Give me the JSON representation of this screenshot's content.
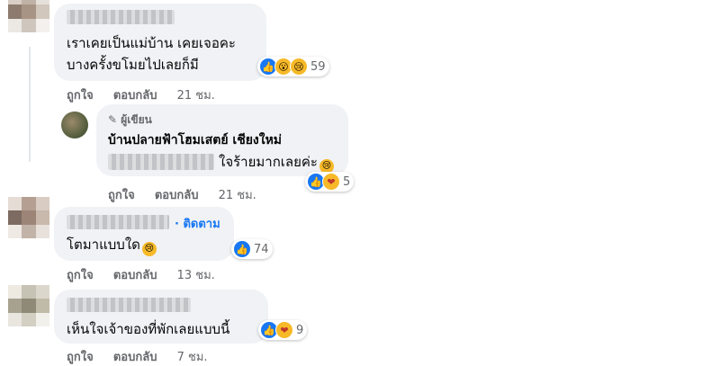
{
  "comments": [
    {
      "body_lines": [
        "เราเคยเป็นแม่บ้าน เคยเจอคะ",
        "บางครั้งขโมยไปเลยก็มี"
      ],
      "reactions": {
        "icons": [
          "like-icon",
          "wow-icon",
          "sad-icon"
        ],
        "count": "59"
      },
      "actions": {
        "like": "ถูกใจ",
        "reply": "ตอบกลับ",
        "time": "21 ชม."
      }
    },
    {
      "badge": "ผู้เขียน",
      "author": "บ้านปลายฟ้าโฮมเสตย์ เชียงใหม่",
      "body": "ใจร้ายมากเลยค่ะ",
      "reactions": {
        "icons": [
          "like-icon",
          "care-icon"
        ],
        "count": "5"
      },
      "actions": {
        "like": "ถูกใจ",
        "reply": "ตอบกลับ",
        "time": "21 ชม."
      }
    },
    {
      "follow": "· ติดตาม",
      "body": "โตมาแบบใด",
      "reactions": {
        "icons": [
          "like-icon"
        ],
        "count": "74"
      },
      "actions": {
        "like": "ถูกใจ",
        "reply": "ตอบกลับ",
        "time": "13 ชม."
      }
    },
    {
      "body": "เห็นใจเจ้าของที่พักเลยแบบนี้",
      "reactions": {
        "icons": [
          "like-icon",
          "care-icon"
        ],
        "count": "9"
      },
      "actions": {
        "like": "ถูกใจ",
        "reply": "ตอบกลับ",
        "time": "7 ชม."
      }
    }
  ],
  "colors": {
    "bubble": "#f0f2f5",
    "link": "#1877f2",
    "meta": "#65676b"
  }
}
